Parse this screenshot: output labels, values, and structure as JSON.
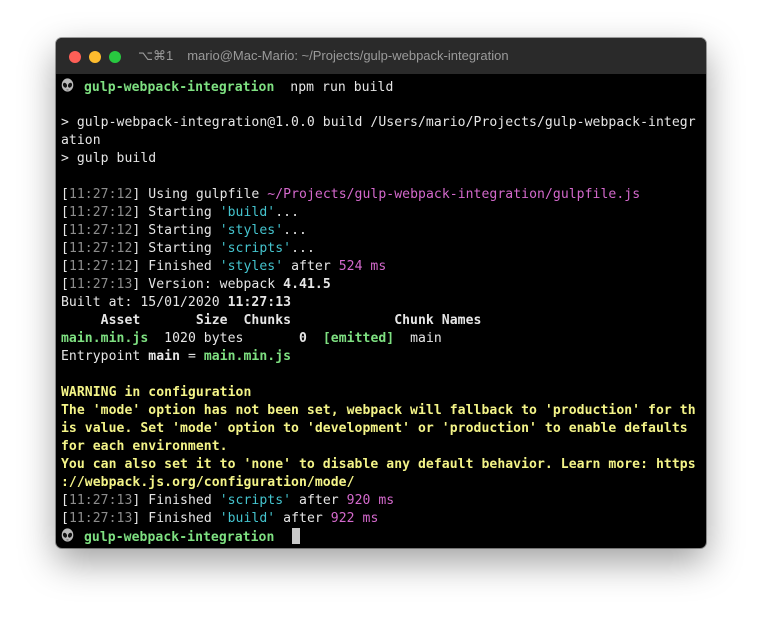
{
  "window": {
    "shortcut": "⌥⌘1",
    "title": "mario@Mac-Mario: ~/Projects/gulp-webpack-integration"
  },
  "colors": {
    "prompt_dir": "#7ee081",
    "string_cyan": "#44c4ce",
    "number_magenta": "#d469cc",
    "warning_yellow": "#f4f488",
    "timestamp_gray": "#8c8c8c"
  },
  "prompt": {
    "icon": "alien-icon",
    "dir": "gulp-webpack-integration",
    "command": "npm run build"
  },
  "npm": {
    "run_line_1": "> gulp-webpack-integration@1.0.0 build /Users/mario/Projects/gulp-webpack-integr",
    "run_line_2": "ation",
    "gulp_line": "> gulp build"
  },
  "log": {
    "ts_1": "11:27:12",
    "ts_2": "11:27:13",
    "using": "Using gulpfile",
    "gulpfile_path": "~/Projects/gulp-webpack-integration/gulpfile.js",
    "starting": "Starting",
    "finished": "Finished",
    "after": "after",
    "task_build": "'build'",
    "task_styles": "'styles'",
    "task_scripts": "'scripts'",
    "ellipsis": "...",
    "styles_time": "524 ms",
    "scripts_time": "920 ms",
    "build_time": "922 ms",
    "version_label": "Version: webpack",
    "version_value": "4.41.5"
  },
  "built": {
    "label": "Built at: 15/01/2020",
    "time": "11:27:13"
  },
  "assets_table": {
    "header": "     Asset       Size  Chunks             Chunk Names",
    "asset_name": "main.min.js",
    "size": "1020 bytes",
    "chunk": "0",
    "emitted": "[emitted]",
    "chunk_name": "main"
  },
  "entrypoint": {
    "label": "Entrypoint",
    "name": "main",
    "eq": "=",
    "file": "main.min.js"
  },
  "warning": {
    "heading": "WARNING in configuration",
    "l1": "The 'mode' option has not been set, webpack will fallback to 'production' for th",
    "l2": "is value. Set 'mode' option to 'development' or 'production' to enable defaults",
    "l3": "for each environment.",
    "l4": "You can also set it to 'none' to disable any default behavior. Learn more: https",
    "l5": "://webpack.js.org/configuration/mode/"
  },
  "final_prompt": {
    "icon": "alien-icon",
    "dir": "gulp-webpack-integration"
  }
}
